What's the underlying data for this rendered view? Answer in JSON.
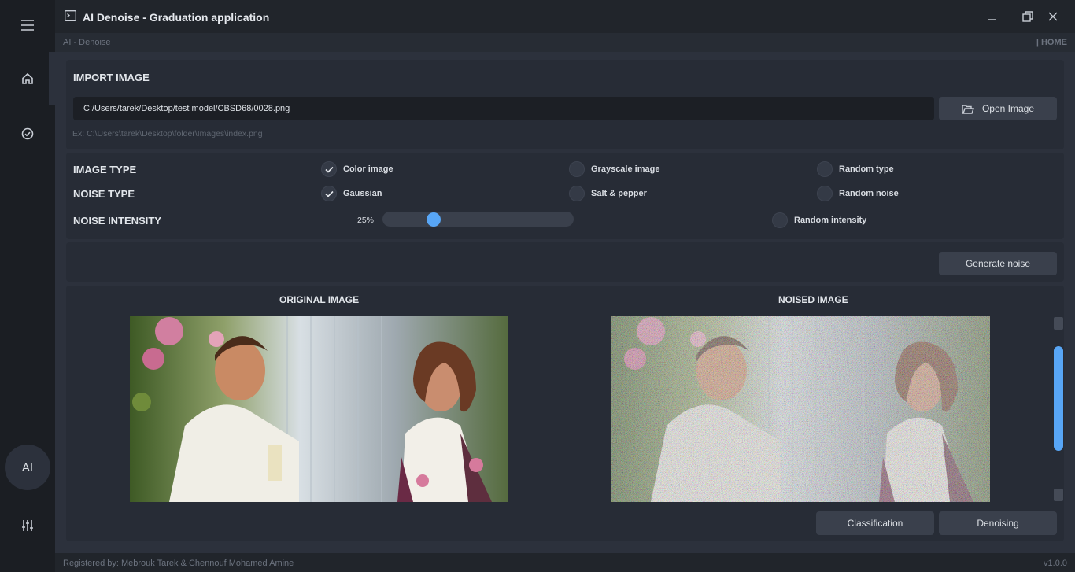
{
  "titlebar": {
    "title": "AI Denoise - Graduation application"
  },
  "breadcrumb": {
    "left": "AI - Denoise",
    "right": "| HOME"
  },
  "sidebar": {
    "ai_label": "AI"
  },
  "import": {
    "heading": "IMPORT IMAGE",
    "path_value": "C:/Users/tarek/Desktop/test model/CBSD68/0028.png",
    "hint": "Ex: C:\\Users\\tarek\\Desktop\\folder\\Images\\index.png",
    "open_button": "Open Image"
  },
  "options": {
    "image_type_label": "IMAGE TYPE",
    "image_types": [
      {
        "label": "Color image",
        "checked": true
      },
      {
        "label": "Grayscale image",
        "checked": false
      },
      {
        "label": "Random type",
        "checked": false
      }
    ],
    "noise_type_label": "NOISE TYPE",
    "noise_types": [
      {
        "label": "Gaussian",
        "checked": true
      },
      {
        "label": "Salt & pepper",
        "checked": false
      },
      {
        "label": "Random noise",
        "checked": false
      }
    ],
    "noise_intensity_label": "NOISE INTENSITY",
    "intensity_text": "25%",
    "intensity_level": 0.25,
    "random_intensity": {
      "label": "Random intensity",
      "checked": false
    }
  },
  "generate_button": "Generate noise",
  "images": {
    "original_title": "ORIGINAL IMAGE",
    "noised_title": "NOISED IMAGE"
  },
  "actions": {
    "classification": "Classification",
    "denoising": "Denoising"
  },
  "footer": {
    "credits": "Registered by: Mebrouk Tarek & Chennouf Mohamed Amine",
    "version": "v1.0.0"
  },
  "colors": {
    "accent": "#58a6f6",
    "background": "#2c313c",
    "sidebar": "#1b1e23"
  }
}
